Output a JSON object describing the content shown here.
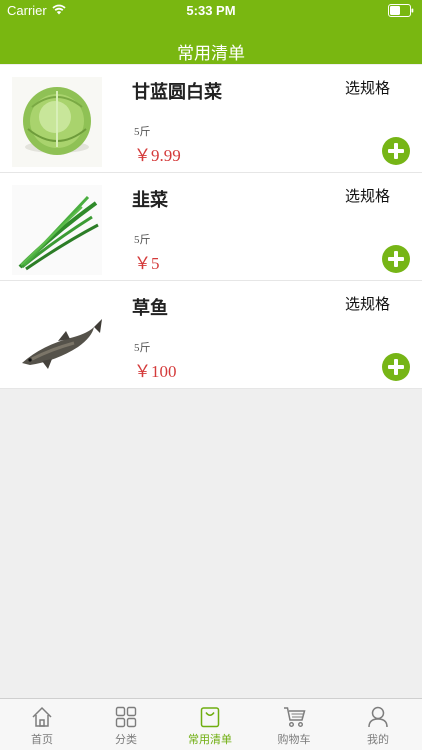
{
  "status_bar": {
    "carrier": "Carrier",
    "time": "5:33 PM"
  },
  "header": {
    "title": "常用清单"
  },
  "products": [
    {
      "name": "甘蓝圆白菜",
      "spec_label": "选规格",
      "unit": "5斤",
      "price": "￥9.99",
      "image_icon": "cabbage-icon"
    },
    {
      "name": "韭菜",
      "spec_label": "选规格",
      "unit": "5斤",
      "price": "￥5",
      "image_icon": "chives-icon"
    },
    {
      "name": "草鱼",
      "spec_label": "选规格",
      "unit": "5斤",
      "price": "￥100",
      "image_icon": "fish-icon"
    }
  ],
  "tabbar": {
    "tabs": [
      {
        "label": "首页",
        "icon": "home-icon",
        "active": false
      },
      {
        "label": "分类",
        "icon": "grid-icon",
        "active": false
      },
      {
        "label": "常用清单",
        "icon": "shopping-bag-icon",
        "active": true
      },
      {
        "label": "购物车",
        "icon": "cart-icon",
        "active": false
      },
      {
        "label": "我的",
        "icon": "user-icon",
        "active": false
      }
    ]
  },
  "colors": {
    "brand": "#79b711",
    "price": "#d43a3a",
    "active_tab": "#6fae10"
  }
}
